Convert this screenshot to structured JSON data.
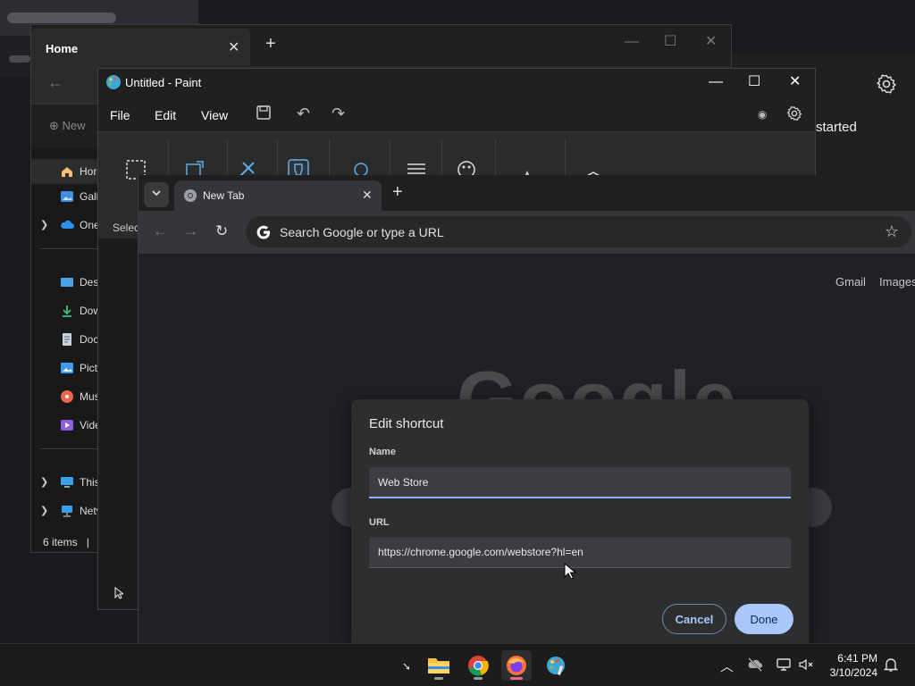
{
  "explorer": {
    "tab_title": "Home",
    "new_label": "New",
    "close_glyph": "✕",
    "newtab_glyph": "+",
    "sidebar": [
      {
        "label": "Hor",
        "icon": "home-icon",
        "active": true
      },
      {
        "label": "Gall",
        "icon": "gallery-icon"
      },
      {
        "label": "One",
        "icon": "onedrive-icon",
        "expandable": true
      },
      {
        "label": "Desl",
        "icon": "desktop-icon"
      },
      {
        "label": "Dow",
        "icon": "downloads-icon"
      },
      {
        "label": "Doc",
        "icon": "documents-icon"
      },
      {
        "label": "Pict",
        "icon": "pictures-icon"
      },
      {
        "label": "Mus",
        "icon": "music-icon"
      },
      {
        "label": "Vide",
        "icon": "videos-icon"
      },
      {
        "label": "This",
        "icon": "this-pc-icon",
        "expandable": true
      },
      {
        "label": "Netv",
        "icon": "network-icon",
        "expandable": true
      }
    ],
    "status": "6 items",
    "status_sep": "|"
  },
  "paint": {
    "title": "Untitled - Paint",
    "menus": [
      "File",
      "Edit",
      "View"
    ],
    "select_label": "Selec"
  },
  "settings": {
    "partial_text": "started"
  },
  "chrome": {
    "tab_title": "New Tab",
    "omnibox_placeholder": "Search Google or type a URL",
    "links": {
      "gmail": "Gmail",
      "images": "Images"
    },
    "logo_text": "Google"
  },
  "dialog": {
    "title": "Edit shortcut",
    "name_label": "Name",
    "name_value": "Web Store",
    "url_label": "URL",
    "url_value": "https://chrome.google.com/webstore?hl=en",
    "cancel_label": "Cancel",
    "done_label": "Done"
  },
  "taskbar": {
    "apps": [
      "file-explorer-icon",
      "chrome-icon",
      "firefox-icon",
      "paint-icon"
    ],
    "active_app": "firefox-icon",
    "time": "6:41 PM",
    "date": "3/10/2024"
  },
  "colors": {
    "accent_blue": "#a8c7fa",
    "focus_blue": "#8ab4f8",
    "dialog_bg": "#2d2e30",
    "chrome_bg": "#202124"
  }
}
